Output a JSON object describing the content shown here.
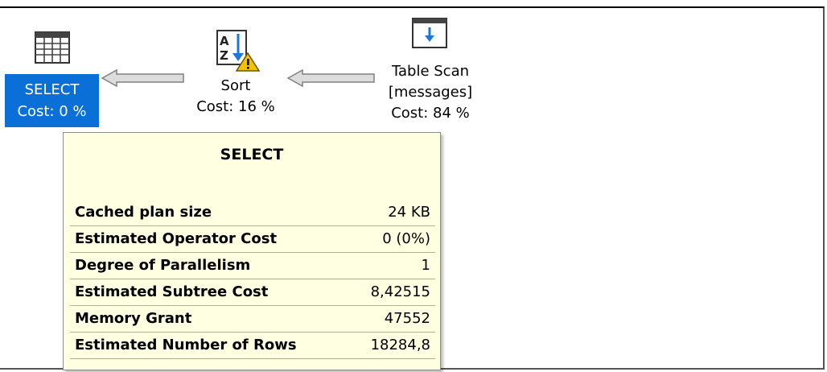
{
  "plan": {
    "select": {
      "line1": "SELECT",
      "line2": "Cost: 0 %"
    },
    "sort": {
      "line1": "Sort",
      "line2": "Cost: 16 %"
    },
    "table_scan": {
      "line1": "Table Scan",
      "line2": "[messages]",
      "line3": "Cost: 84 %"
    }
  },
  "tooltip": {
    "title": "SELECT",
    "rows": [
      {
        "key": "Cached plan size",
        "value": "24 KB"
      },
      {
        "key": "Estimated Operator Cost",
        "value": "0 (0%)"
      },
      {
        "key": "Degree of Parallelism",
        "value": "1"
      },
      {
        "key": "Estimated Subtree Cost",
        "value": "8,42515"
      },
      {
        "key": "Memory Grant",
        "value": "47552"
      },
      {
        "key": "Estimated Number of Rows",
        "value": "18284,8"
      }
    ]
  },
  "colors": {
    "selection": "#0a6fd6",
    "tooltip_bg": "#ffffe1",
    "icon_blue": "#1e78d2",
    "warning": "#f2c200"
  },
  "icons": {
    "select": "grid-table-icon",
    "sort": "sort-az-warning-icon",
    "scan": "table-scan-icon"
  }
}
